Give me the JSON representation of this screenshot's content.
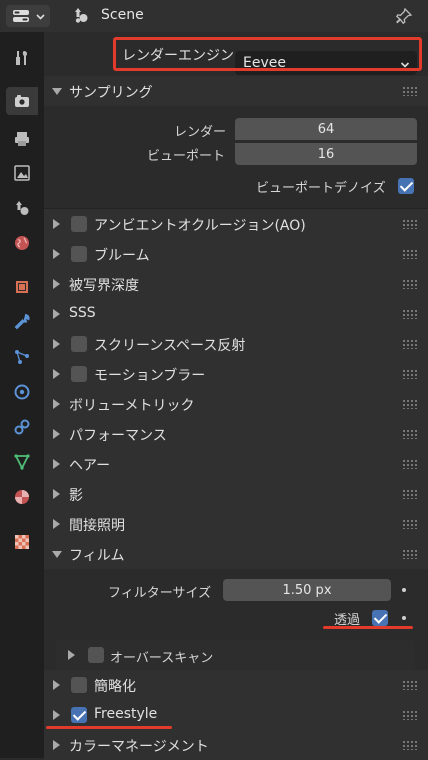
{
  "header": {
    "scene_title": "Scene"
  },
  "render_engine": {
    "label": "レンダーエンジン",
    "value": "Eevee"
  },
  "sampling": {
    "title": "サンプリング",
    "render_label": "レンダー",
    "render_value": "64",
    "viewport_label": "ビューポート",
    "viewport_value": "16",
    "viewport_denoise_label": "ビューポートデノイズ",
    "viewport_denoise_checked": true
  },
  "panels": {
    "ao": {
      "label": "アンビエントオクルージョン(AO)",
      "checked": false
    },
    "bloom": {
      "label": "ブルーム",
      "checked": false
    },
    "dof": {
      "label": "被写界深度"
    },
    "sss": {
      "label": "SSS"
    },
    "ssr": {
      "label": "スクリーンスペース反射",
      "checked": false
    },
    "motion_blur": {
      "label": "モーションブラー",
      "checked": false
    },
    "volumetrics": {
      "label": "ボリューメトリック"
    },
    "performance": {
      "label": "パフォーマンス"
    },
    "hair": {
      "label": "ヘアー"
    },
    "shadows": {
      "label": "影"
    },
    "indirect": {
      "label": "間接照明"
    },
    "film": {
      "label": "フィルム",
      "filter_size_label": "フィルターサイズ",
      "filter_size_value": "1.50 px",
      "transparent_label": "透過",
      "transparent_checked": true,
      "overscan_label": "オーバースキャン",
      "overscan_checked": false
    },
    "simplify": {
      "label": "簡略化",
      "checked": false
    },
    "freestyle": {
      "label": "Freestyle",
      "checked": true
    },
    "color_management": {
      "label": "カラーマネージメント"
    }
  },
  "colors": {
    "accent_blue": "#4772b3",
    "highlight_red": "#e23b2b"
  }
}
